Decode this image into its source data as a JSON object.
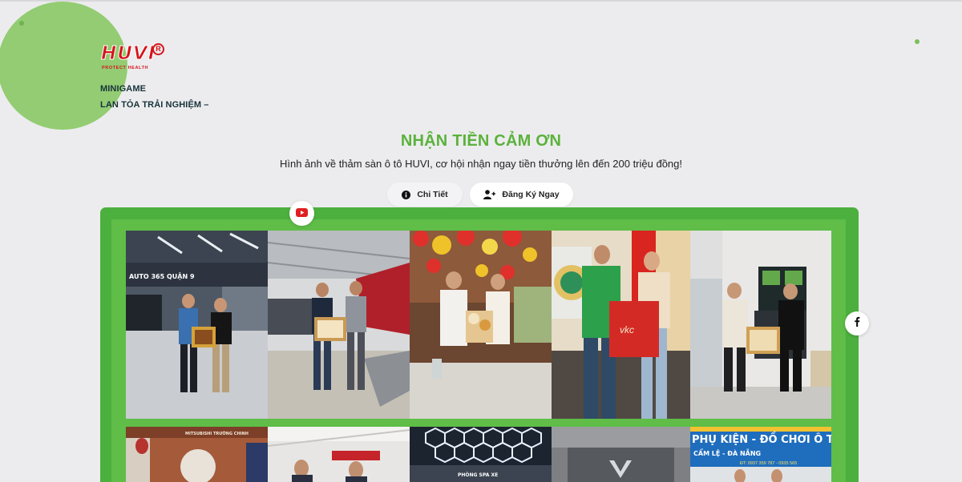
{
  "brand": {
    "logo_text": "HUVI",
    "logo_registered": "R",
    "logo_tagline": "PROTECT HEALTH"
  },
  "intro": {
    "line1": "MINIGAME",
    "line2": "LAN TỎA TRẢI NGHIỆM –"
  },
  "hero": {
    "title": "NHẬN TIỀN CẢM ƠN",
    "subtitle": "Hình ảnh về thảm sàn ô tô HUVI, cơ hội nhận ngay tiền thưởng lên đến 200 triệu đồng!"
  },
  "actions": {
    "details_label": "Chi Tiết",
    "register_label": "Đăng Ký Ngay"
  },
  "gallery": {
    "photo1_sign": "AUTO 365 QUẬN 9",
    "photo6_sign": "MITSUBISHI TRƯỜNG CHINH",
    "photo8_sign": "PHÒNG SPA XE",
    "photo10_sign_line1": "PHỤ KIỆN - ĐỒ CHƠI Ô T",
    "photo10_sign_line2": "CẨM LỆ - ĐÀ NẴNG",
    "photo10_phone": "ĐT: 0937 359 787 - 0935 565"
  },
  "social": {
    "youtube_icon": "youtube-icon",
    "facebook_icon": "facebook-icon"
  },
  "colors": {
    "brand_green": "#5bb23c",
    "frame_green": "#4cb03f",
    "logo_red": "#d6141b",
    "deco_circle": "#93cc72"
  }
}
